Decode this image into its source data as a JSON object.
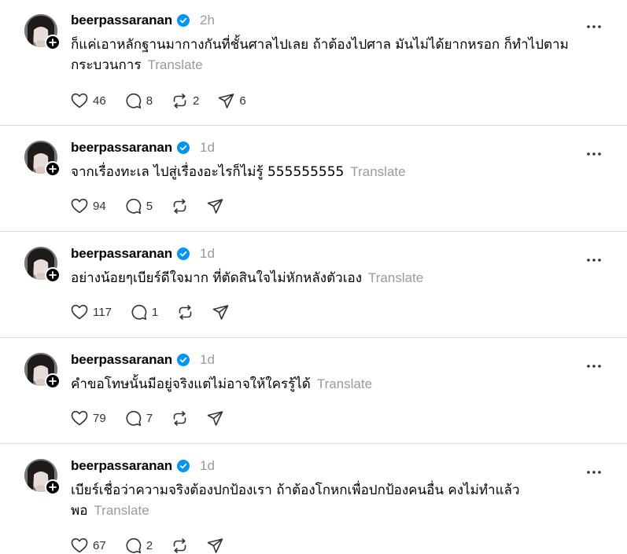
{
  "posts": [
    {
      "username": "beerpassaranan",
      "time": "2h",
      "text": "ก็แค่เอาหลักฐานมากางกันที่ชั้นศาลไปเลย ถ้าต้องไปศาล มันไม่ได้ยากหรอก ก็ทำไปตาม",
      "text2": "กระบวนการ",
      "translate": "Translate",
      "likes": "46",
      "replies": "8",
      "reposts": "2",
      "shares": "6"
    },
    {
      "username": "beerpassaranan",
      "time": "1d",
      "text": "จากเรื่องทะเล ไปสู่เรื่องอะไรก็ไม่รู้ 555555555",
      "translate": "Translate",
      "likes": "94",
      "replies": "5"
    },
    {
      "username": "beerpassaranan",
      "time": "1d",
      "text": "อย่างน้อยๆเบียร์ดีใจมาก ที่ตัดสินใจไม่หักหลังตัวเอง",
      "translate": "Translate",
      "likes": "117",
      "replies": "1"
    },
    {
      "username": "beerpassaranan",
      "time": "1d",
      "text": "คำขอโทษนั้นมีอยู่จริงแต่ไม่อาจให้ใครรู้ได้",
      "translate": "Translate",
      "likes": "79",
      "replies": "7"
    },
    {
      "username": "beerpassaranan",
      "time": "1d",
      "text": "เบียร์เชื่อว่าความจริงต้องปกป้องเรา ถ้าต้องโกหกเพื่อปกป้องคนอื่น คงไม่ทำแล้ว",
      "text2": "พอ",
      "translate": "Translate",
      "likes": "67",
      "replies": "2"
    }
  ],
  "colors": {
    "verified": "#0095f6",
    "muted": "#9a9a9a",
    "divider": "#dcdcdc"
  },
  "icons": [
    "heart-icon",
    "comment-icon",
    "repost-icon",
    "share-icon",
    "more-icon",
    "verified-icon",
    "follow-plus-icon"
  ]
}
